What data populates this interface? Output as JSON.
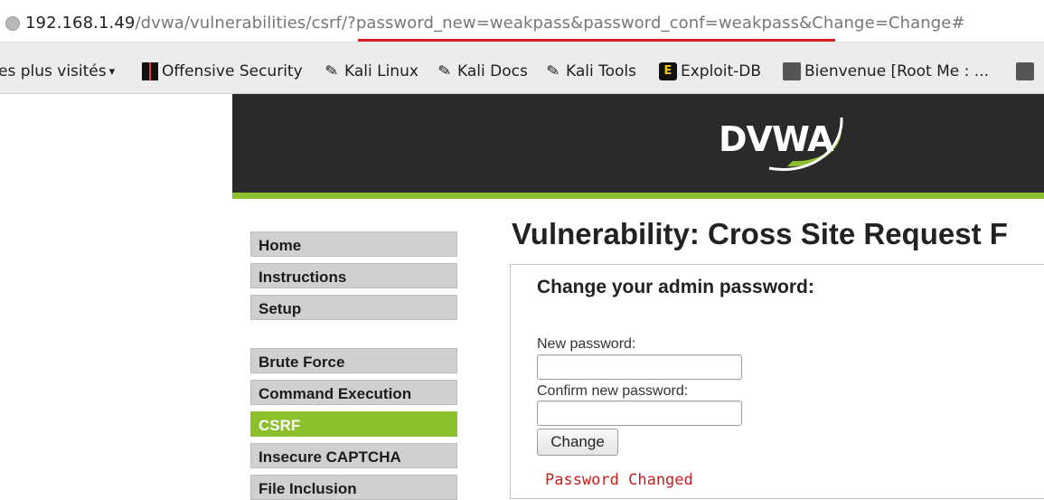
{
  "browser": {
    "url_host": "192.168.1.49",
    "url_path": "/dvwa/vulnerabilities/csrf/?",
    "url_query": "password_new=weakpass&password_conf=weakpass&Change=Change#",
    "bookmarks": [
      {
        "label": "es plus visités",
        "icon": "chevron-down-icon"
      },
      {
        "label": "Offensive Security",
        "icon": "offensive-security-icon"
      },
      {
        "label": "Kali Linux",
        "icon": "kali-dragon-icon"
      },
      {
        "label": "Kali Docs",
        "icon": "kali-dragon-icon"
      },
      {
        "label": "Kali Tools",
        "icon": "kali-dragon-icon"
      },
      {
        "label": "Exploit-DB",
        "icon": "exploit-db-icon"
      },
      {
        "label": "Bienvenue [Root Me : ...",
        "icon": "root-me-icon"
      }
    ]
  },
  "header": {
    "logo_text": "DVWA",
    "accent_color": "#8bc02c"
  },
  "menu": {
    "group1": [
      "Home",
      "Instructions",
      "Setup"
    ],
    "group2": [
      "Brute Force",
      "Command Execution",
      "CSRF",
      "Insecure CAPTCHA",
      "File Inclusion"
    ],
    "active": "CSRF"
  },
  "main": {
    "title": "Vulnerability: Cross Site Request F",
    "form_title": "Change your admin password:",
    "new_password_label": "New password:",
    "confirm_password_label": "Confirm new password:",
    "new_password_value": "",
    "confirm_password_value": "",
    "submit_label": "Change",
    "result_message": "Password Changed",
    "result_color": "#cc1d1d"
  }
}
